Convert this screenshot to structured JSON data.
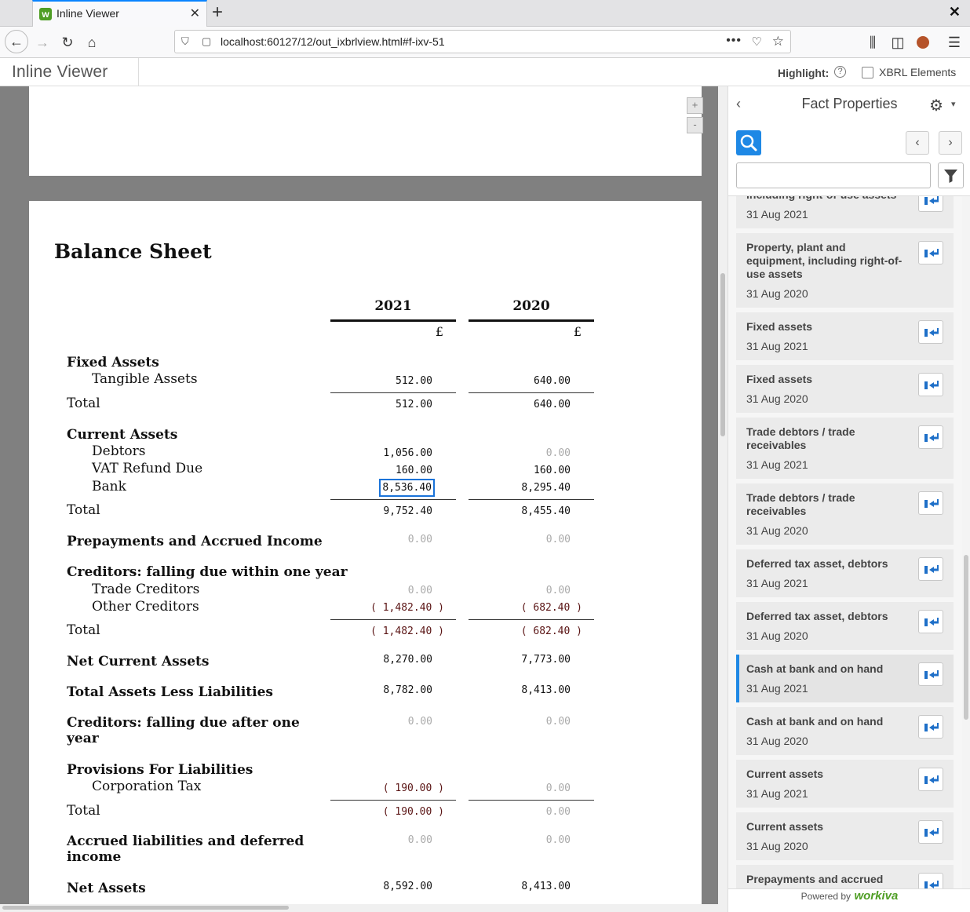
{
  "browser": {
    "tab_title": "Inline Viewer",
    "url": "localhost:60127/12/out_ixbrlview.html#f-ixv-51",
    "dots": "•••"
  },
  "app": {
    "title": "Inline Viewer",
    "highlight_label": "Highlight:",
    "xbrl_label": "XBRL Elements"
  },
  "document": {
    "title": "Balance Sheet",
    "years": [
      "2021",
      "2020"
    ],
    "currency": "£",
    "zoom_in": "+",
    "zoom_out": "-",
    "rows": [
      {
        "label": "Fixed Assets",
        "bold": true
      },
      {
        "label": "Tangible Assets",
        "v2021": "512.00",
        "v2020": "640.00"
      },
      {
        "label": "Total",
        "v2021": "512.00",
        "v2020": "640.00"
      },
      {
        "label": "Current Assets",
        "bold": true
      },
      {
        "label": "Debtors",
        "v2021": "1,056.00",
        "v2020": "0.00"
      },
      {
        "label": "VAT Refund Due",
        "v2021": "160.00",
        "v2020": "160.00"
      },
      {
        "label": "Bank",
        "v2021": "8,536.40",
        "v2020": "8,295.40"
      },
      {
        "label": "Total",
        "v2021": "9,752.40",
        "v2020": "8,455.40"
      },
      {
        "label": "Prepayments and Accrued Income",
        "bold": true,
        "v2021": "0.00",
        "v2020": "0.00"
      },
      {
        "label": "Creditors: falling due within one year",
        "bold": true
      },
      {
        "label": "Trade Creditors",
        "v2021": "0.00",
        "v2020": "0.00"
      },
      {
        "label": "Other Creditors",
        "v2021": "( 1,482.40 )",
        "v2020": "( 682.40 )"
      },
      {
        "label": "Total",
        "v2021": "( 1,482.40 )",
        "v2020": "( 682.40 )"
      },
      {
        "label": "Net Current Assets",
        "bold": true,
        "v2021": "8,270.00",
        "v2020": "7,773.00"
      },
      {
        "label": "Total Assets Less Liabilities",
        "bold": true,
        "v2021": "8,782.00",
        "v2020": "8,413.00"
      },
      {
        "label_line1": "Creditors: falling due after one",
        "label_line2": "year",
        "bold": true,
        "v2021": "0.00",
        "v2020": "0.00"
      },
      {
        "label": "Provisions For Liabilities",
        "bold": true
      },
      {
        "label": "Corporation Tax",
        "v2021": "( 190.00 )",
        "v2020": "0.00"
      },
      {
        "label": "Total",
        "v2021": "( 190.00 )",
        "v2020": "0.00"
      },
      {
        "label_line1": "Accrued liabilities and deferred",
        "label_line2": "income",
        "bold": true,
        "v2021": "0.00",
        "v2020": "0.00"
      },
      {
        "label": "Net Assets",
        "bold": true,
        "v2021": "8,592.00",
        "v2020": "8,413.00"
      }
    ]
  },
  "panel": {
    "title": "Fact Properties",
    "powered_by": "Powered by",
    "brand": "workiva",
    "facts": [
      {
        "name": "including right-of-use assets",
        "date": "31 Aug 2021"
      },
      {
        "name": "Property, plant and equipment, including right-of-use assets",
        "date": "31 Aug 2020"
      },
      {
        "name": "Fixed assets",
        "date": "31 Aug 2021"
      },
      {
        "name": "Fixed assets",
        "date": "31 Aug 2020"
      },
      {
        "name": "Trade debtors / trade receivables",
        "date": "31 Aug 2021"
      },
      {
        "name": "Trade debtors / trade receivables",
        "date": "31 Aug 2020"
      },
      {
        "name": "Deferred tax asset, debtors",
        "date": "31 Aug 2021"
      },
      {
        "name": "Deferred tax asset, debtors",
        "date": "31 Aug 2020"
      },
      {
        "name": "Cash at bank and on hand",
        "date": "31 Aug 2021",
        "selected": true
      },
      {
        "name": "Cash at bank and on hand",
        "date": "31 Aug 2020"
      },
      {
        "name": "Current assets",
        "date": "31 Aug 2021"
      },
      {
        "name": "Current assets",
        "date": "31 Aug 2020"
      },
      {
        "name": "Prepayments and accrued income, not expressed within",
        "date": ""
      }
    ]
  }
}
